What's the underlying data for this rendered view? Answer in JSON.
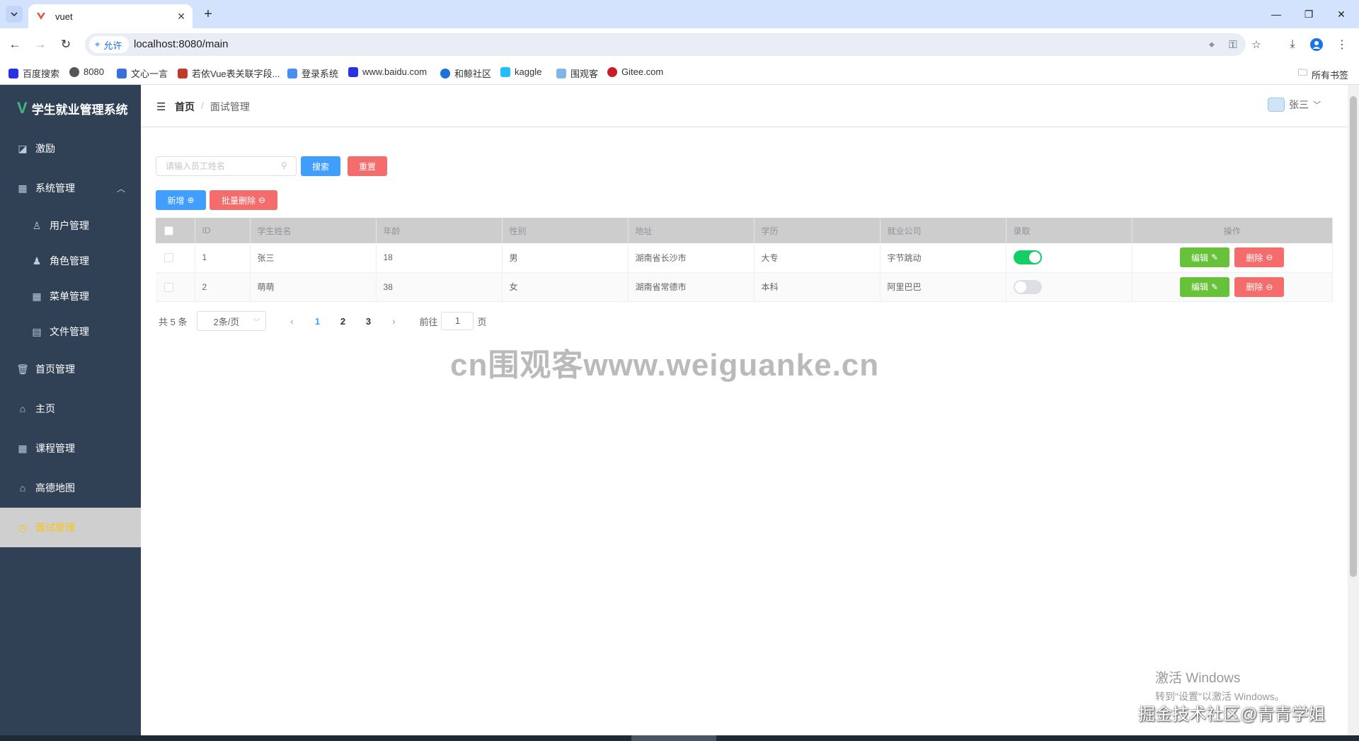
{
  "browser": {
    "tab_title": "vuet",
    "url": "localhost:8080/main",
    "site_chip": "允许",
    "bookmarks": [
      "百度搜索",
      "8080",
      "文心一言",
      "若依Vue表关联字段...",
      "登录系统",
      "www.baidu.com",
      "和鲸社区",
      "kaggle",
      "围观客",
      "Gitee.com"
    ],
    "all_bookmarks": "所有书签"
  },
  "sidebar": {
    "logo_title": "学生就业管理系统",
    "items": [
      {
        "label": "激励",
        "icon": "chart-icon"
      },
      {
        "label": "系统管理",
        "icon": "grid-icon"
      },
      {
        "label": "用户管理",
        "icon": "user-icon"
      },
      {
        "label": "角色管理",
        "icon": "role-icon"
      },
      {
        "label": "菜单管理",
        "icon": "menu-icon"
      },
      {
        "label": "文件管理",
        "icon": "file-icon"
      },
      {
        "label": "首页管理",
        "icon": "trash-icon"
      },
      {
        "label": "主页",
        "icon": "home-icon"
      },
      {
        "label": "课程管理",
        "icon": "grid-icon"
      },
      {
        "label": "高德地图",
        "icon": "home-icon"
      },
      {
        "label": "面试管理",
        "icon": "clock-icon"
      }
    ],
    "active_color": "#f5c518"
  },
  "header": {
    "breadcrumb_home": "首页",
    "breadcrumb_sep": "/",
    "breadcrumb_current": "面试管理",
    "username": "张三"
  },
  "toolbar": {
    "search_placeholder": "请输入员工姓名",
    "search_label": "搜索",
    "reset_label": "重置",
    "add_label": "新增",
    "batch_delete_label": "批量删除"
  },
  "table": {
    "columns": [
      "ID",
      "学生姓名",
      "年龄",
      "性别",
      "地址",
      "学历",
      "就业公司",
      "录取",
      "操作"
    ],
    "rows": [
      {
        "id": "1",
        "name": "张三",
        "age": "18",
        "gender": "男",
        "address": "湖南省长沙市",
        "education": "大专",
        "company": "字节跳动",
        "admitted": true
      },
      {
        "id": "2",
        "name": "萌萌",
        "age": "38",
        "gender": "女",
        "address": "湖南省常德市",
        "education": "本科",
        "company": "阿里巴巴",
        "admitted": false
      }
    ],
    "edit_label": "编辑",
    "delete_label": "删除"
  },
  "pagination": {
    "total": "共 5 条",
    "page_size": "2条/页",
    "pages": [
      "1",
      "2",
      "3"
    ],
    "current_page": "1",
    "goto_prefix": "前往",
    "goto_value": "1",
    "goto_suffix": "页"
  },
  "overlays": {
    "watermark": "cn围观客www.weiguanke.cn",
    "activate_line1": "激活 Windows",
    "activate_line2": "转到\"设置\"以激活 Windows。",
    "juejin": "掘金技术社区@青青学姐"
  }
}
